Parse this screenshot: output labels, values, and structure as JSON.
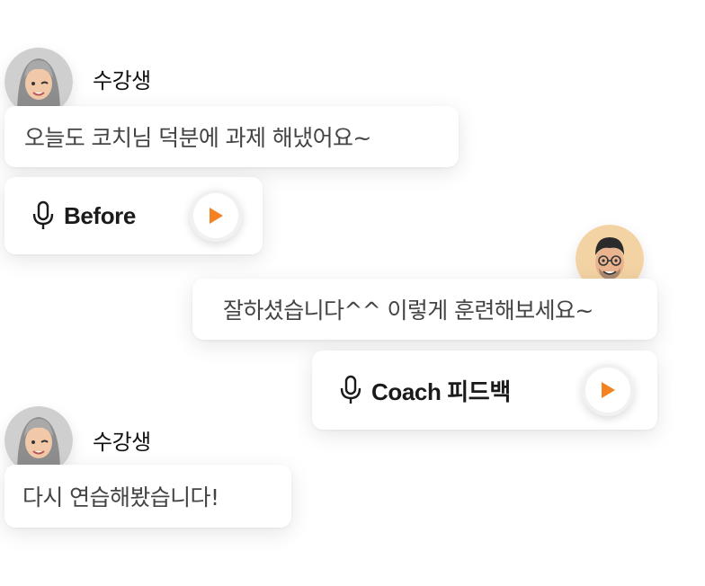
{
  "messages": [
    {
      "sender": "수강생",
      "avatar_icon": "student-memoji-avatar",
      "text": "오늘도 코치님 덕분에 과제 해냈어요~",
      "audio_label": "Before"
    },
    {
      "sender_avatar_icon": "coach-memoji-avatar",
      "text": "잘하셨습니다^^ 이렇게 훈련해보세요~",
      "audio_label": "Coach 피드백"
    },
    {
      "sender": "수강생",
      "avatar_icon": "student-memoji-avatar",
      "text": "다시 연습해봤습니다!"
    }
  ],
  "icons": {
    "mic": "microphone-icon",
    "play": "play-icon"
  },
  "colors": {
    "accent": "#F58220",
    "bubble_bg": "#FFFFFF",
    "text": "#444444"
  }
}
